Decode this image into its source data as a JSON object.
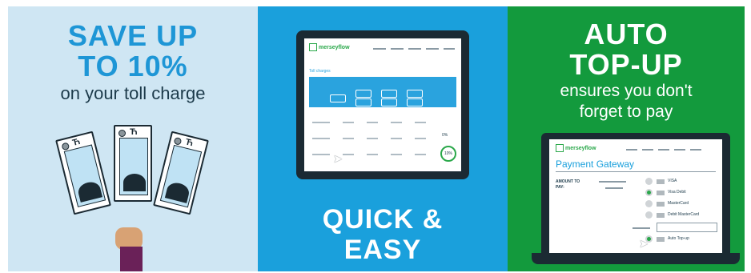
{
  "panels": {
    "savings": {
      "headline_line1": "SAVE UP",
      "headline_line2": "TO 10%",
      "subtitle": "on your toll charge"
    },
    "quick": {
      "headline_line1": "QUICK &",
      "headline_line2": "EASY",
      "tablet": {
        "logo": "merseyflow",
        "table_title": "Toll charges",
        "percent_zero": "0%",
        "percent_ten": "10%"
      }
    },
    "autotopup": {
      "headline_line1": "AUTO",
      "headline_line2": "TOP-UP",
      "subtitle_line1": "ensures you don't",
      "subtitle_line2": "forget to pay",
      "laptop": {
        "logo": "merseyflow",
        "page_title": "Payment Gateway",
        "amount_label": "AMOUNT TO PAY:",
        "options": [
          "VISA",
          "Visa Debit",
          "MasterCard",
          "Debit MasterCard",
          "Auto Top-up"
        ]
      }
    }
  },
  "colors": {
    "light_blue_bg": "#cfe6f3",
    "blue_bg": "#1aa0dc",
    "green_bg": "#139a3d",
    "headline_blue": "#1e96d6"
  }
}
